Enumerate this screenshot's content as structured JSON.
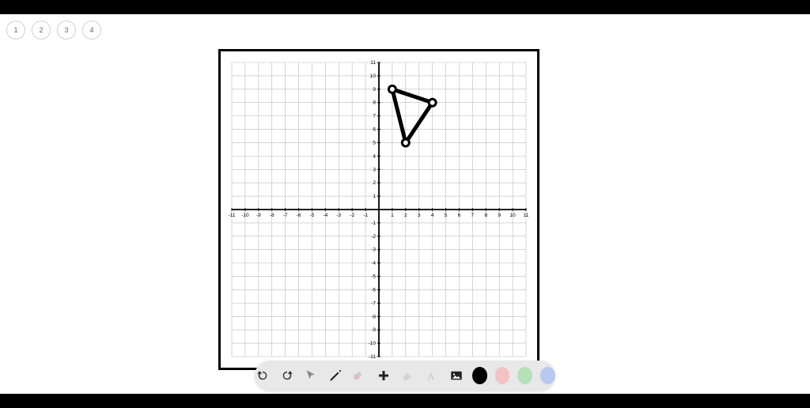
{
  "pages": [
    "1",
    "2",
    "3",
    "4"
  ],
  "chart_data": {
    "type": "scatter",
    "title": "",
    "xlabel": "",
    "ylabel": "",
    "xlim": [
      -11,
      11
    ],
    "ylim": [
      -11,
      11
    ],
    "x_ticks": [
      -11,
      -10,
      -9,
      -8,
      -7,
      -6,
      -5,
      -4,
      -3,
      -2,
      -1,
      1,
      2,
      3,
      4,
      5,
      6,
      7,
      8,
      9,
      10,
      11
    ],
    "y_ticks": [
      -11,
      -10,
      -9,
      -8,
      -7,
      -6,
      -5,
      -4,
      -3,
      -2,
      -1,
      1,
      2,
      3,
      4,
      5,
      6,
      7,
      8,
      9,
      10,
      11
    ],
    "grid": true,
    "series": [
      {
        "name": "triangle",
        "shape": "polygon",
        "points": [
          {
            "x": 1,
            "y": 9
          },
          {
            "x": 4,
            "y": 8
          },
          {
            "x": 2,
            "y": 5
          }
        ],
        "stroke_width": 5,
        "vertex_marker": "circle-open"
      }
    ]
  },
  "toolbar": {
    "undo": "Undo",
    "redo": "Redo",
    "select": "Select",
    "pencil": "Pencil",
    "shapes": "Shapes",
    "add": "Add",
    "erase": "Erase",
    "text": "Text",
    "image": "Image"
  },
  "colors": {
    "black": "#000000",
    "pink": "#f4c2c2",
    "green": "#b8e0b8",
    "blue": "#b8c8f0"
  }
}
